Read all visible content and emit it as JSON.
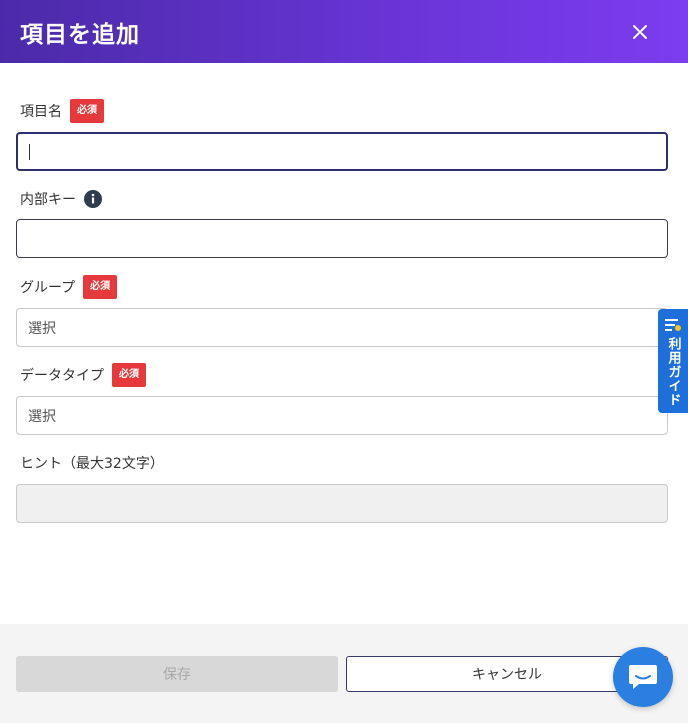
{
  "header": {
    "title": "項目を追加"
  },
  "fields": {
    "item_name": {
      "label": "項目名",
      "badge": "必須",
      "value": ""
    },
    "internal_key": {
      "label": "内部キー",
      "value": ""
    },
    "group": {
      "label": "グループ",
      "badge": "必須",
      "placeholder": "選択"
    },
    "data_type": {
      "label": "データタイプ",
      "badge": "必須",
      "placeholder": "選択"
    },
    "hint": {
      "label": "ヒント（最大32文字）",
      "value": ""
    }
  },
  "footer": {
    "save_label": "保存",
    "cancel_label": "キャンセル"
  },
  "guide": {
    "label": "利用ガイド"
  },
  "colors": {
    "header_start": "#4b2aa8",
    "header_end": "#7d3cf0",
    "required_badge": "#e6393b",
    "guide_tab": "#1e6fd9",
    "chat_button": "#2b7fe0"
  },
  "icons": {
    "close": "close-icon",
    "info": "info-icon",
    "guide": "guide-list-icon",
    "chat": "chat-bubble-icon"
  }
}
